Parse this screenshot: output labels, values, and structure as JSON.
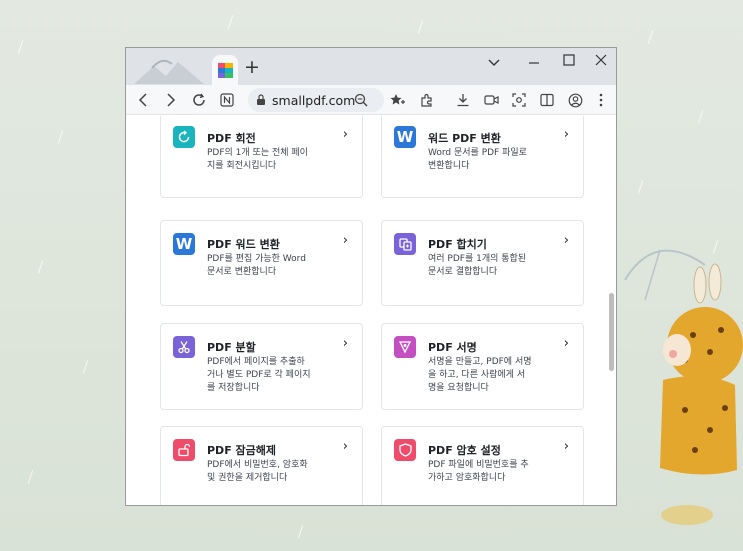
{
  "browser": {
    "url": "smallpdf.com",
    "new_tab_label": "+",
    "window_controls": [
      "chevron-down-icon",
      "minimize-icon",
      "maximize-icon",
      "close-icon"
    ]
  },
  "cards": [
    {
      "title": "PDF 회전",
      "desc_lines": [
        "PDF의 1개 또는 전체 페이",
        "지를 회전시킵니다"
      ],
      "icon": "rotate-icon",
      "color": "#19b4be"
    },
    {
      "title": "워드 PDF 변환",
      "desc_lines": [
        "Word 문서를 PDF 파일로",
        "변환합니다"
      ],
      "icon": "word-icon",
      "color": "#2b78d8"
    },
    {
      "title": "PDF 워드 변환",
      "desc_lines": [
        "PDF를 편집 가능한 Word",
        "문서로 변환합니다"
      ],
      "icon": "word-icon",
      "color": "#2b78d8"
    },
    {
      "title": "PDF 합치기",
      "desc_lines": [
        "여러 PDF를 1개의 통합된",
        "문서로 결합합니다"
      ],
      "icon": "merge-icon",
      "color": "#7a63d8"
    },
    {
      "title": "PDF 분할",
      "desc_lines": [
        "PDF에서 페이지를 추출하",
        "거나 별도 PDF로 각 페이지",
        "를 저장합니다"
      ],
      "icon": "scissors-icon",
      "color": "#7a63d8"
    },
    {
      "title": "PDF 서명",
      "desc_lines": [
        "서명을 만들고, PDF에 서명",
        "을 하고, 다른 사람에게 서",
        "명을 요청합니다"
      ],
      "icon": "signature-icon",
      "color": "#c44fc0"
    },
    {
      "title": "PDF 잠금해제",
      "desc_lines": [
        "PDF에서 비밀번호, 암호화",
        "및 권한을 제거합니다"
      ],
      "icon": "unlock-icon",
      "color": "#ef4b6a"
    },
    {
      "title": "PDF 암호 설정",
      "desc_lines": [
        "PDF 파일에 비밀번호를 추",
        "가하고 암호화합니다"
      ],
      "icon": "shield-icon",
      "color": "#ef4b6a"
    }
  ],
  "word_icon_letter": "W",
  "chevron": "›"
}
